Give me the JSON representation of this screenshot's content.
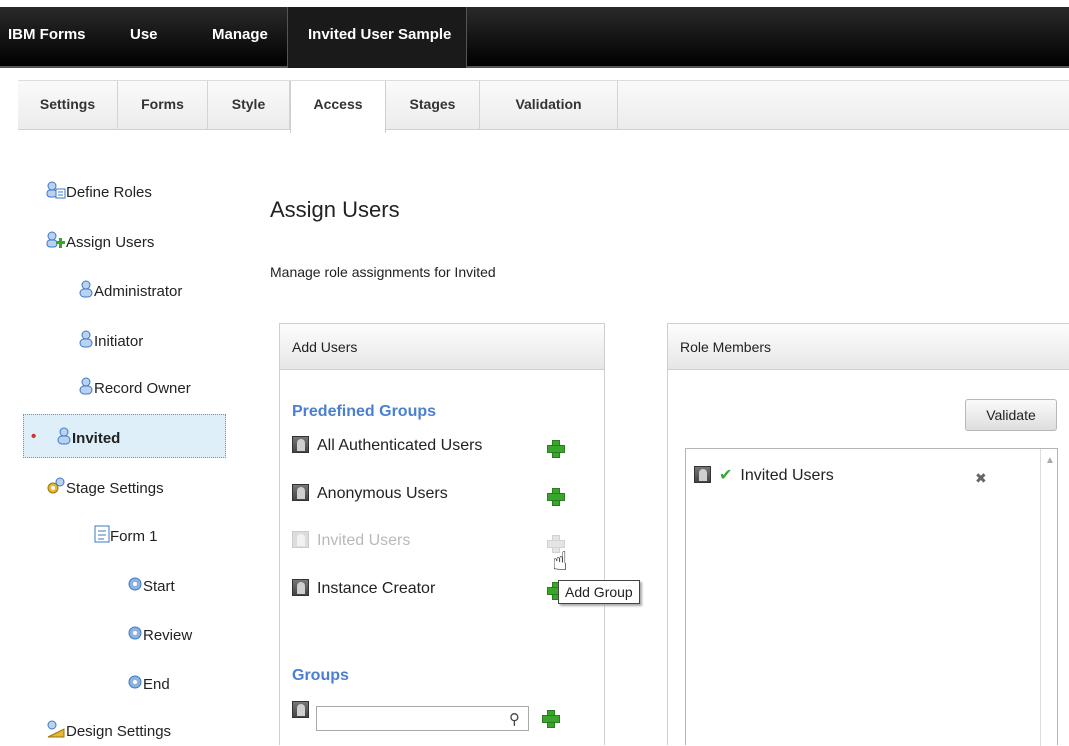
{
  "topbar": {
    "brand": "IBM Forms",
    "nav": [
      "Use",
      "Manage"
    ],
    "app_tab": "Invited User Sample"
  },
  "tabs": [
    "Settings",
    "Forms",
    "Style",
    "Access",
    "Stages",
    "Validation"
  ],
  "active_tab": "Access",
  "tree": {
    "define_roles": "Define Roles",
    "assign_users": "Assign Users",
    "administrator": "Administrator",
    "initiator": "Initiator",
    "record_owner": "Record Owner",
    "invited": "Invited",
    "stage_settings": "Stage Settings",
    "form1": "Form 1",
    "start": "Start",
    "review": "Review",
    "end": "End",
    "design_settings": "Design Settings"
  },
  "main": {
    "title": "Assign Users",
    "subtitle": "Manage role assignments for Invited"
  },
  "add_users": {
    "header": "Add Users",
    "predefined_label": "Predefined Groups",
    "groups": [
      "All Authenticated Users",
      "Anonymous Users",
      "Invited Users",
      "Instance Creator"
    ],
    "groups_label": "Groups",
    "search_placeholder": "",
    "tooltip": "Add Group"
  },
  "role_members": {
    "header": "Role Members",
    "validate": "Validate",
    "members": [
      "Invited Users"
    ]
  },
  "colors": {
    "accent": "#4a7fd2",
    "plus": "#39a62b",
    "selected": "#dfeff9"
  }
}
